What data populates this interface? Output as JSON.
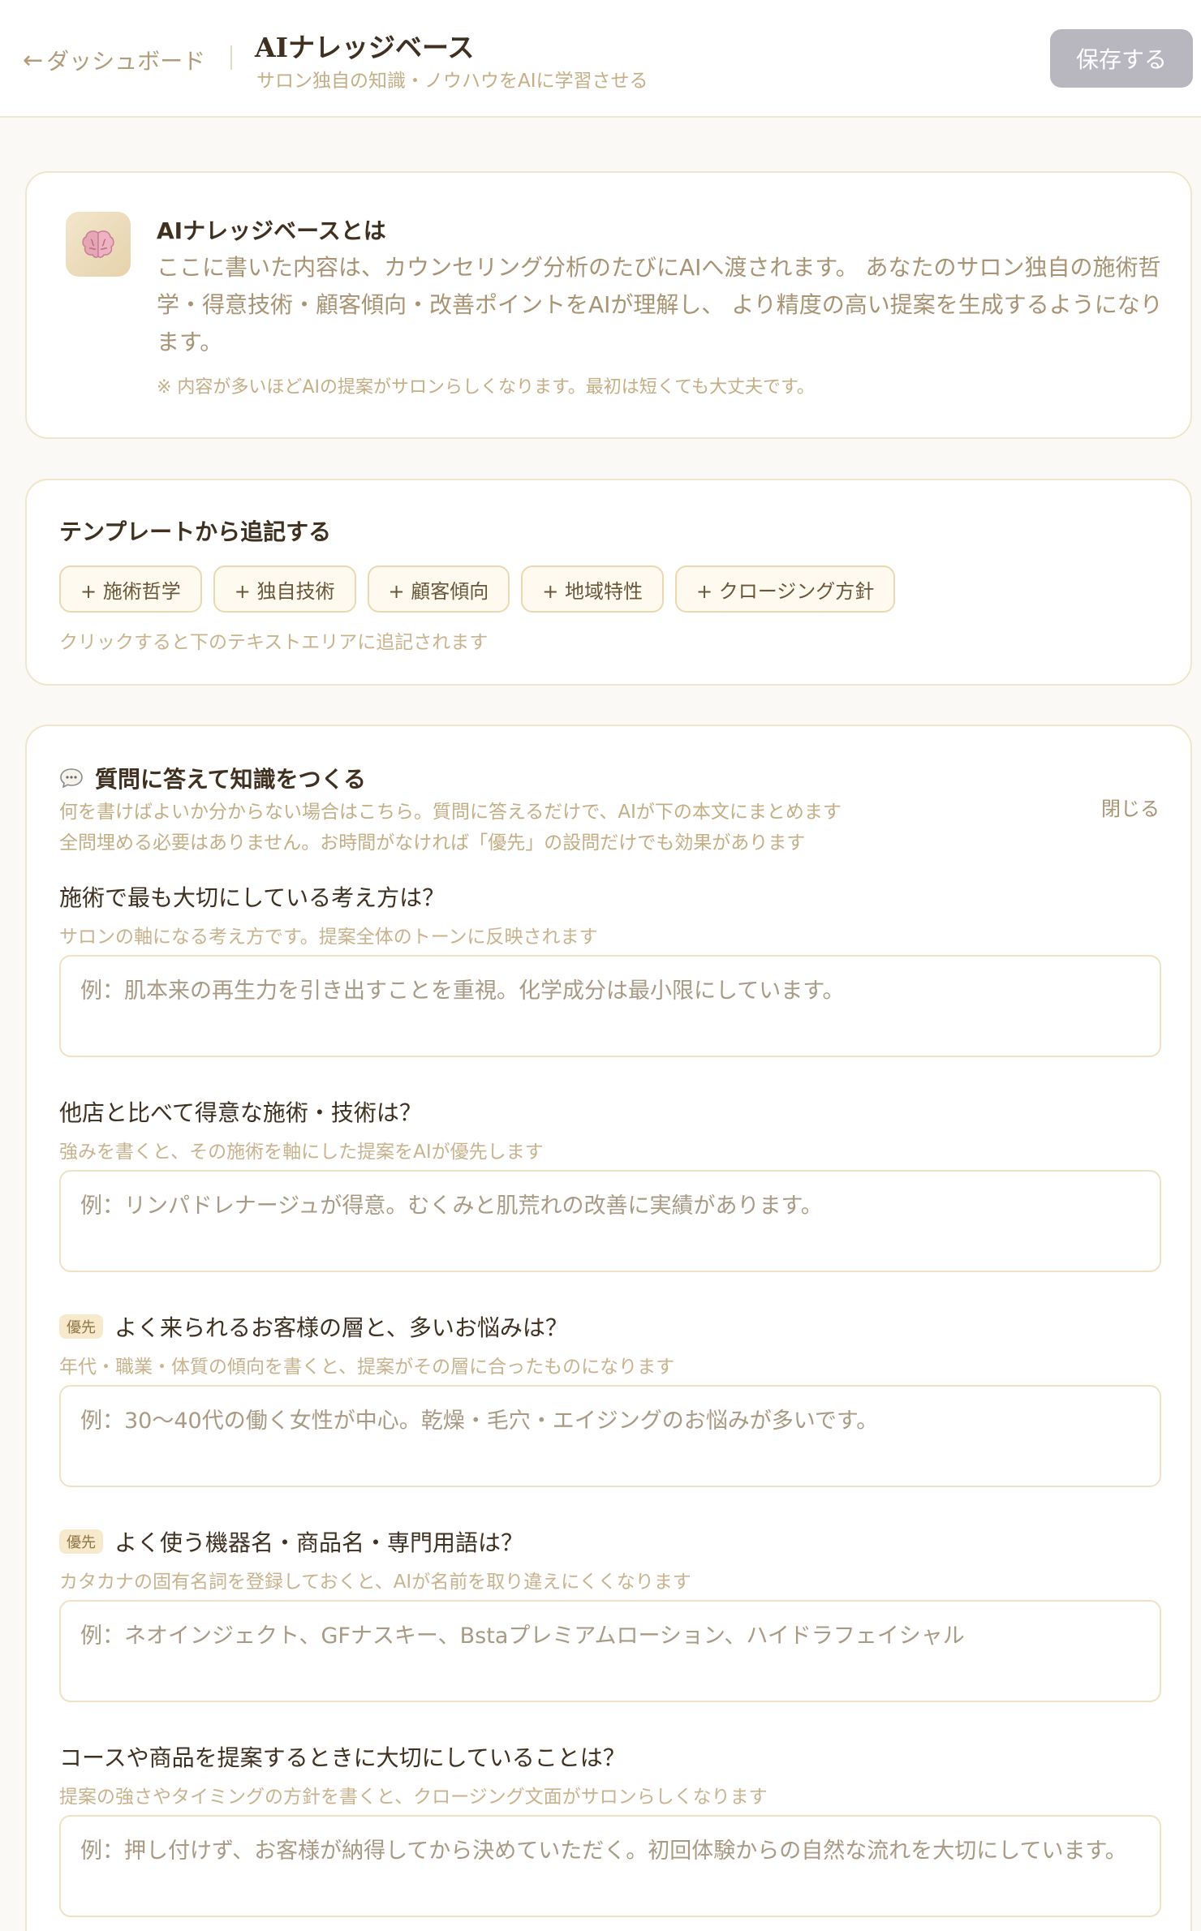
{
  "header": {
    "back_arrow": "←",
    "back_label": "ダッシュボード",
    "title": "AIナレッジベース",
    "subtitle": "サロン独自の知識・ノウハウをAIに学習させる",
    "save_label": "保存する"
  },
  "intro": {
    "icon": "brain-icon",
    "title": "AIナレッジベースとは",
    "body": "ここに書いた内容は、カウンセリング分析のたびにAIへ渡されます。 あなたのサロン独自の施術哲学・得意技術・顧客傾向・改善ポイントをAIが理解し、 より精度の高い提案を生成するようになります。",
    "note": "※ 内容が多いほどAIの提案がサロンらしくなります。最初は短くても大丈夫です。"
  },
  "template": {
    "title": "テンプレートから追記する",
    "chips": [
      "+ 施術哲学",
      "+ 独自技術",
      "+ 顧客傾向",
      "+ 地域特性",
      "+ クロージング方針"
    ],
    "hint": "クリックすると下のテキストエリアに追記されます"
  },
  "qa": {
    "icon": "chat-bubble-icon",
    "title": "質問に答えて知識をつくる",
    "close_label": "閉じる",
    "desc_1": "何を書けばよいか分からない場合はこちら。質問に答えるだけで、AIが下の本文にまとめます",
    "desc_2": "全問埋める必要はありません。お時間がなければ「優先」の設問だけでも効果があります",
    "questions": [
      {
        "priority": false,
        "question": "施術で最も大切にしている考え方は？",
        "hint": "サロンの軸になる考え方です。提案全体のトーンに反映されます",
        "placeholder": "例：肌本来の再生力を引き出すことを重視。化学成分は最小限にしています。"
      },
      {
        "priority": false,
        "question": "他店と比べて得意な施術・技術は？",
        "hint": "強みを書くと、その施術を軸にした提案をAIが優先します",
        "placeholder": "例：リンパドレナージュが得意。むくみと肌荒れの改善に実績があります。"
      },
      {
        "priority": true,
        "badge": "優先",
        "question": "よく来られるお客様の層と、多いお悩みは？",
        "hint": "年代・職業・体質の傾向を書くと、提案がその層に合ったものになります",
        "placeholder": "例：30〜40代の働く女性が中心。乾燥・毛穴・エイジングのお悩みが多いです。"
      },
      {
        "priority": true,
        "badge": "優先",
        "question": "よく使う機器名・商品名・専門用語は？",
        "hint": "カタカナの固有名詞を登録しておくと、AIが名前を取り違えにくくなります",
        "placeholder": "例：ネオインジェクト、GFナスキー、Bstaプレミアムローション、ハイドラフェイシャル"
      },
      {
        "priority": false,
        "question": "コースや商品を提案するときに大切にしていることは？",
        "hint": "提案の強さやタイミングの方針を書くと、クロージング文面がサロンらしくなります",
        "placeholder": "例：押し付けず、お客様が納得してから決めていただく。初回体験からの自然な流れを大切にしています。"
      }
    ]
  },
  "colors": {
    "accent": "#b29c7a",
    "title_text": "#3f3020",
    "border": "#f0e5cd",
    "save_button_bg": "#b8b6be",
    "badge_bg": "#f6e9cc"
  }
}
